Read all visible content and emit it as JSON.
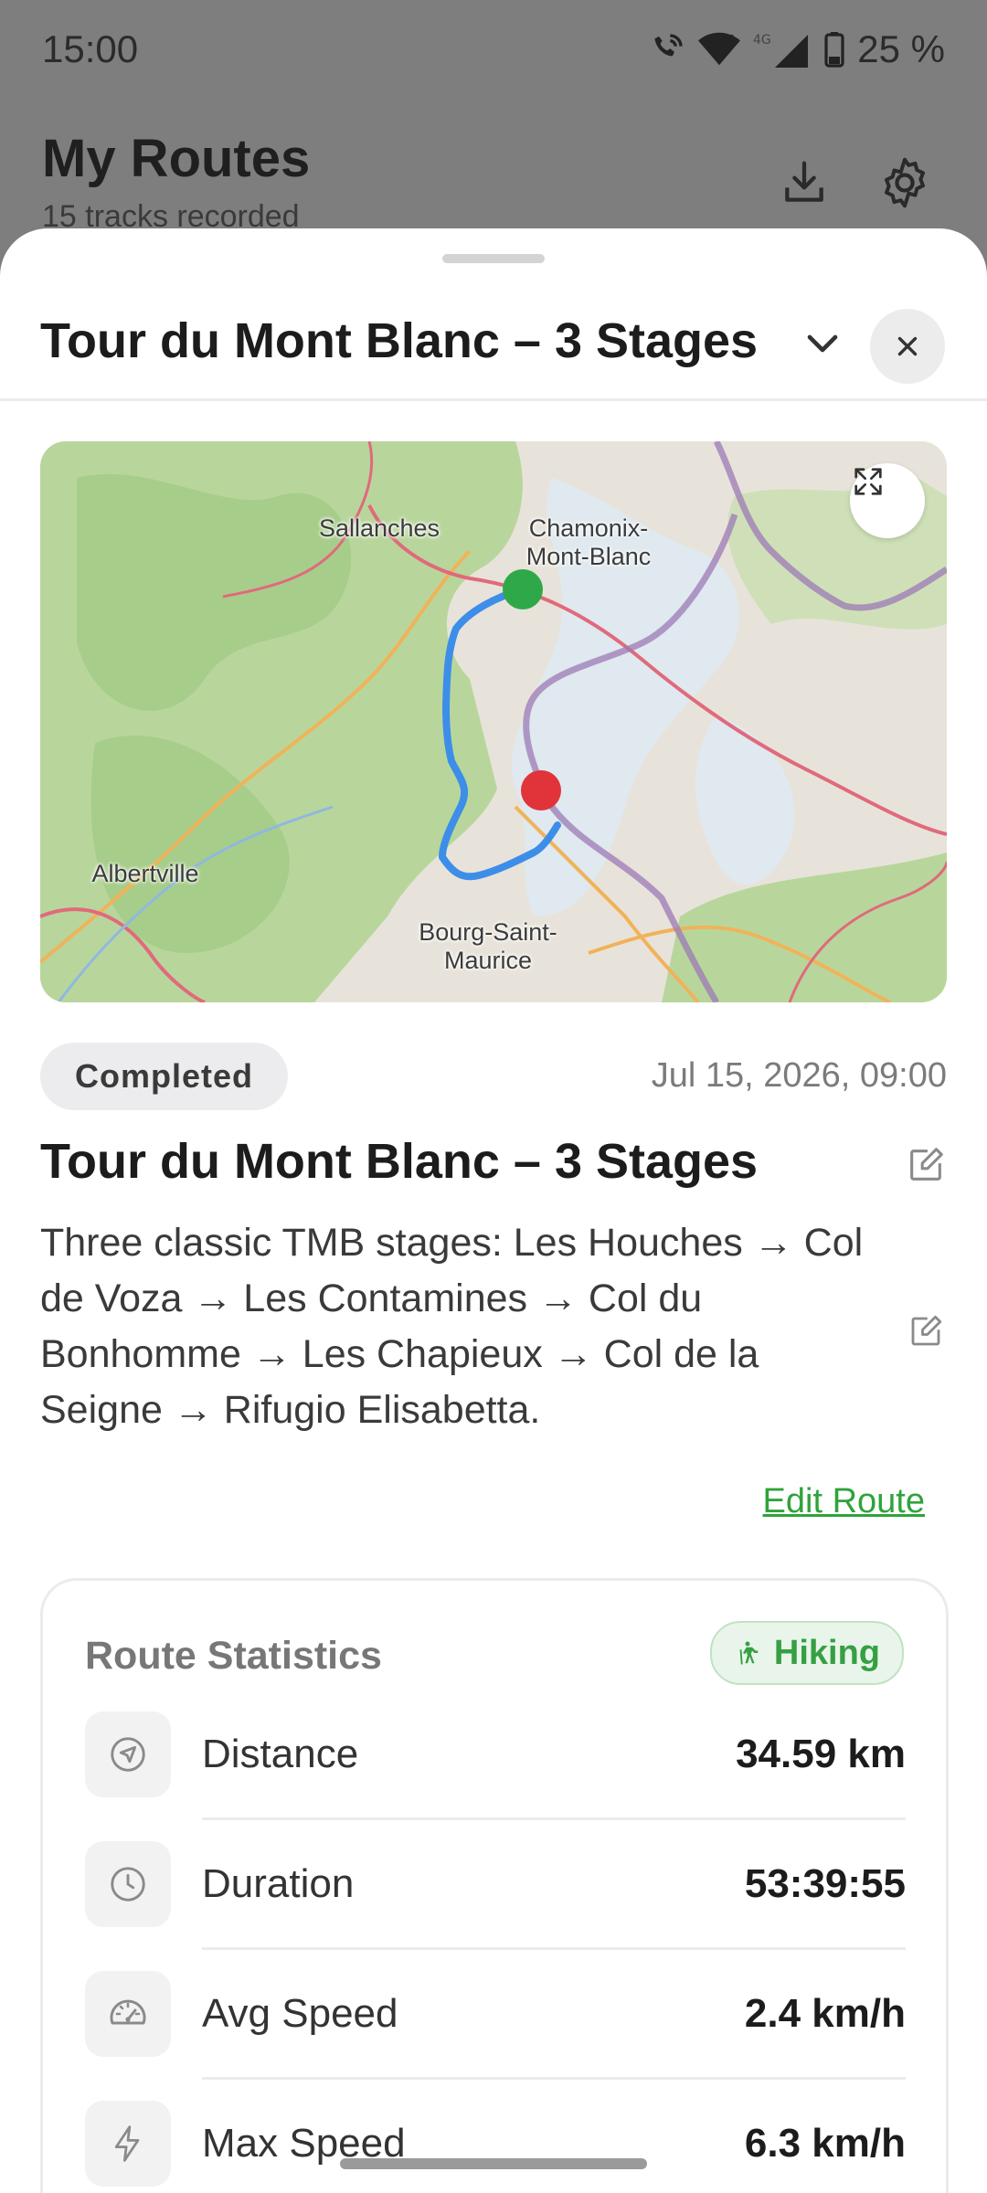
{
  "status_bar": {
    "time": "15:00",
    "battery": "25 %",
    "icons": [
      "wifi-calling-icon",
      "wifi-icon",
      "cell-signal-icon",
      "battery-icon"
    ]
  },
  "background": {
    "title": "My Routes",
    "subtitle": "15 tracks recorded",
    "icons": [
      "download-icon",
      "gear-icon"
    ]
  },
  "sheet": {
    "header_title": "Tour du Mont Blanc – 3 Stages",
    "map": {
      "labels": {
        "sallanches": "Sallanches",
        "chamonix": "Chamonix-\nMont-Blanc",
        "albertville": "Albertville",
        "bourg": "Bourg-Saint-\nMaurice"
      },
      "route_color": "#3d8ee8",
      "start_marker_color": "#2fa84a",
      "end_marker_color": "#e0343a"
    },
    "status": "Completed",
    "date": "Jul 15, 2026, 09:00",
    "route_name": "Tour du Mont Blanc – 3 Stages",
    "description": "Three classic TMB stages: Les Houches → Col de Voza → Les Contamines → Col du Bonhomme → Les Chapieux → Col de la Seigne → Rifugio Elisabetta.",
    "edit_route_label": "Edit Route",
    "stats": {
      "title": "Route Statistics",
      "activity": "Hiking",
      "rows": [
        {
          "label": "Distance",
          "value": "34.59 km",
          "icon": "navigation-arrow-icon"
        },
        {
          "label": "Duration",
          "value": "53:39:55",
          "icon": "clock-icon"
        },
        {
          "label": "Avg Speed",
          "value": "2.4 km/h",
          "icon": "speedometer-icon"
        },
        {
          "label": "Max Speed",
          "value": "6.3 km/h",
          "icon": "lightning-icon"
        }
      ]
    }
  },
  "colors": {
    "accent_green": "#2fa33a",
    "scrim": "#7e7e7e"
  }
}
